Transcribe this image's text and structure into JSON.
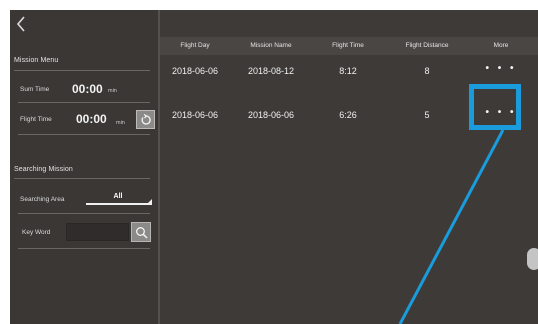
{
  "nav": {
    "back_icon": "chevron-left-icon"
  },
  "sidebar": {
    "mission_menu_title": "Mission Menu",
    "sum_time_label": "Sum Time",
    "sum_time_value": "00:00",
    "sum_time_unit": "min",
    "flight_time_label": "Flight Time",
    "flight_time_value": "00:00",
    "flight_time_unit": "min",
    "reset_icon": "refresh-icon",
    "searching_mission_title": "Searching Mission",
    "searching_area_label": "Searching Area",
    "searching_area_value": "All",
    "key_word_label": "Key Word",
    "key_word_value": "",
    "search_icon": "search-icon"
  },
  "table": {
    "columns": [
      "Flight Day",
      "Mission Name",
      "Flight Time",
      "Flight Distance",
      "More"
    ],
    "rows": [
      {
        "flight_day": "2018-06-06",
        "mission_name": "2018-08-12",
        "flight_time": "8:12",
        "flight_distance": "8",
        "more": "• • •"
      },
      {
        "flight_day": "2018-06-06",
        "mission_name": "2018-06-06",
        "flight_time": "6:26",
        "flight_distance": "5",
        "more": "• • •"
      }
    ]
  },
  "colors": {
    "background": "#3d3a38",
    "header": "#4a4643",
    "highlight": "#1a9bdc"
  }
}
